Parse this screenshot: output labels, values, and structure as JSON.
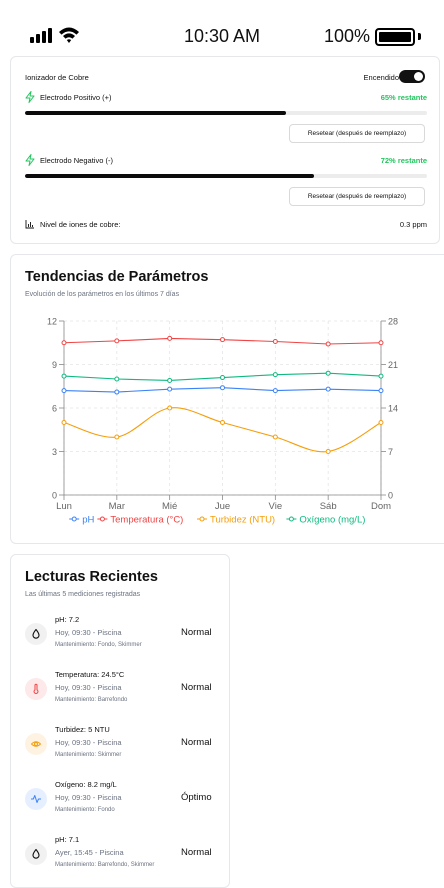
{
  "status_bar": {
    "time": "10:30 AM",
    "battery": "100%"
  },
  "ionizer": {
    "title": "Ionizador de Cobre",
    "status": "Encendido",
    "positive": {
      "name": "Electrodo Positivo (+)",
      "remaining_label": "65% restante",
      "level": 0.65
    },
    "negative": {
      "name": "Electrodo Negativo (-)",
      "remaining_label": "72% restante",
      "level": 0.72
    },
    "reset_label": "Resetear (después de reemplazo)",
    "level_label": "Nivel de iones de cobre:",
    "level_value": "0.3 ppm",
    "accent_color": "#22c55e"
  },
  "chart_section": {
    "title": "Tendencias de Parámetros",
    "subtitle": "Evolución de los parámetros en los últimos 7 días"
  },
  "chart_data": {
    "type": "line",
    "categories": [
      "Lun",
      "Mar",
      "Mié",
      "Jue",
      "Vie",
      "Sáb",
      "Dom"
    ],
    "y_left": {
      "ticks": [
        "0",
        "3",
        "6",
        "9",
        "12"
      ],
      "lim": [
        0,
        12
      ]
    },
    "y_right": {
      "ticks": [
        "0",
        "7",
        "14",
        "21",
        "28"
      ],
      "lim": [
        0,
        28
      ]
    },
    "grid": true,
    "legend": "bottom",
    "series": [
      {
        "name": "pH",
        "axis": "left",
        "color": "#3b82f6",
        "values": [
          7.2,
          7.1,
          7.3,
          7.4,
          7.2,
          7.3,
          7.2
        ],
        "curve": false
      },
      {
        "name": "Temperatura (°C)",
        "axis": "right",
        "color": "#ef4444",
        "values": [
          24.5,
          24.8,
          25.2,
          25.0,
          24.7,
          24.3,
          24.5
        ],
        "curve": false
      },
      {
        "name": "Turbidez (NTU)",
        "axis": "left",
        "color": "#f59e0b",
        "values": [
          5,
          4,
          6,
          5,
          4,
          3,
          5
        ],
        "curve": true
      },
      {
        "name": "Oxígeno (mg/L)",
        "axis": "left",
        "color": "#10b981",
        "values": [
          8.2,
          8.0,
          7.9,
          8.1,
          8.3,
          8.4,
          8.2
        ],
        "curve": false
      }
    ]
  },
  "readings_section": {
    "title": "Lecturas Recientes",
    "subtitle": "Las últimas 5 mediciones registradas",
    "items": [
      {
        "icon": "droplet-icon",
        "title": "pH: 7.2",
        "time": "Hoy, 09:30 - Piscina",
        "maintenance": "Mantenimiento: Fondo, Skimmer",
        "status": "Normal",
        "bg": "#f1f1f1",
        "fg": "#111111"
      },
      {
        "icon": "thermometer-icon",
        "title": "Temperatura: 24.5°C",
        "time": "Hoy, 09:30 - Piscina",
        "maintenance": "Mantenimiento: Barrefondo",
        "status": "Normal",
        "bg": "#fde8ea",
        "fg": "#ef4444"
      },
      {
        "icon": "eye-icon",
        "title": "Turbidez: 5 NTU",
        "time": "Hoy, 09:30 - Piscina",
        "maintenance": "Mantenimiento: Skimmer",
        "status": "Normal",
        "bg": "#fef3e2",
        "fg": "#f59e0b"
      },
      {
        "icon": "activity-icon",
        "title": "Oxígeno: 8.2 mg/L",
        "time": "Hoy, 09:30 - Piscina",
        "maintenance": "Mantenimiento: Fondo",
        "status": "Óptimo",
        "bg": "#e6efff",
        "fg": "#3b82f6"
      },
      {
        "icon": "droplet-icon",
        "title": "pH: 7.1",
        "time": "Ayer, 15:45 - Piscina",
        "maintenance": "Mantenimiento: Barrefondo, Skimmer",
        "status": "Normal",
        "bg": "#f1f1f1",
        "fg": "#111111"
      }
    ]
  }
}
